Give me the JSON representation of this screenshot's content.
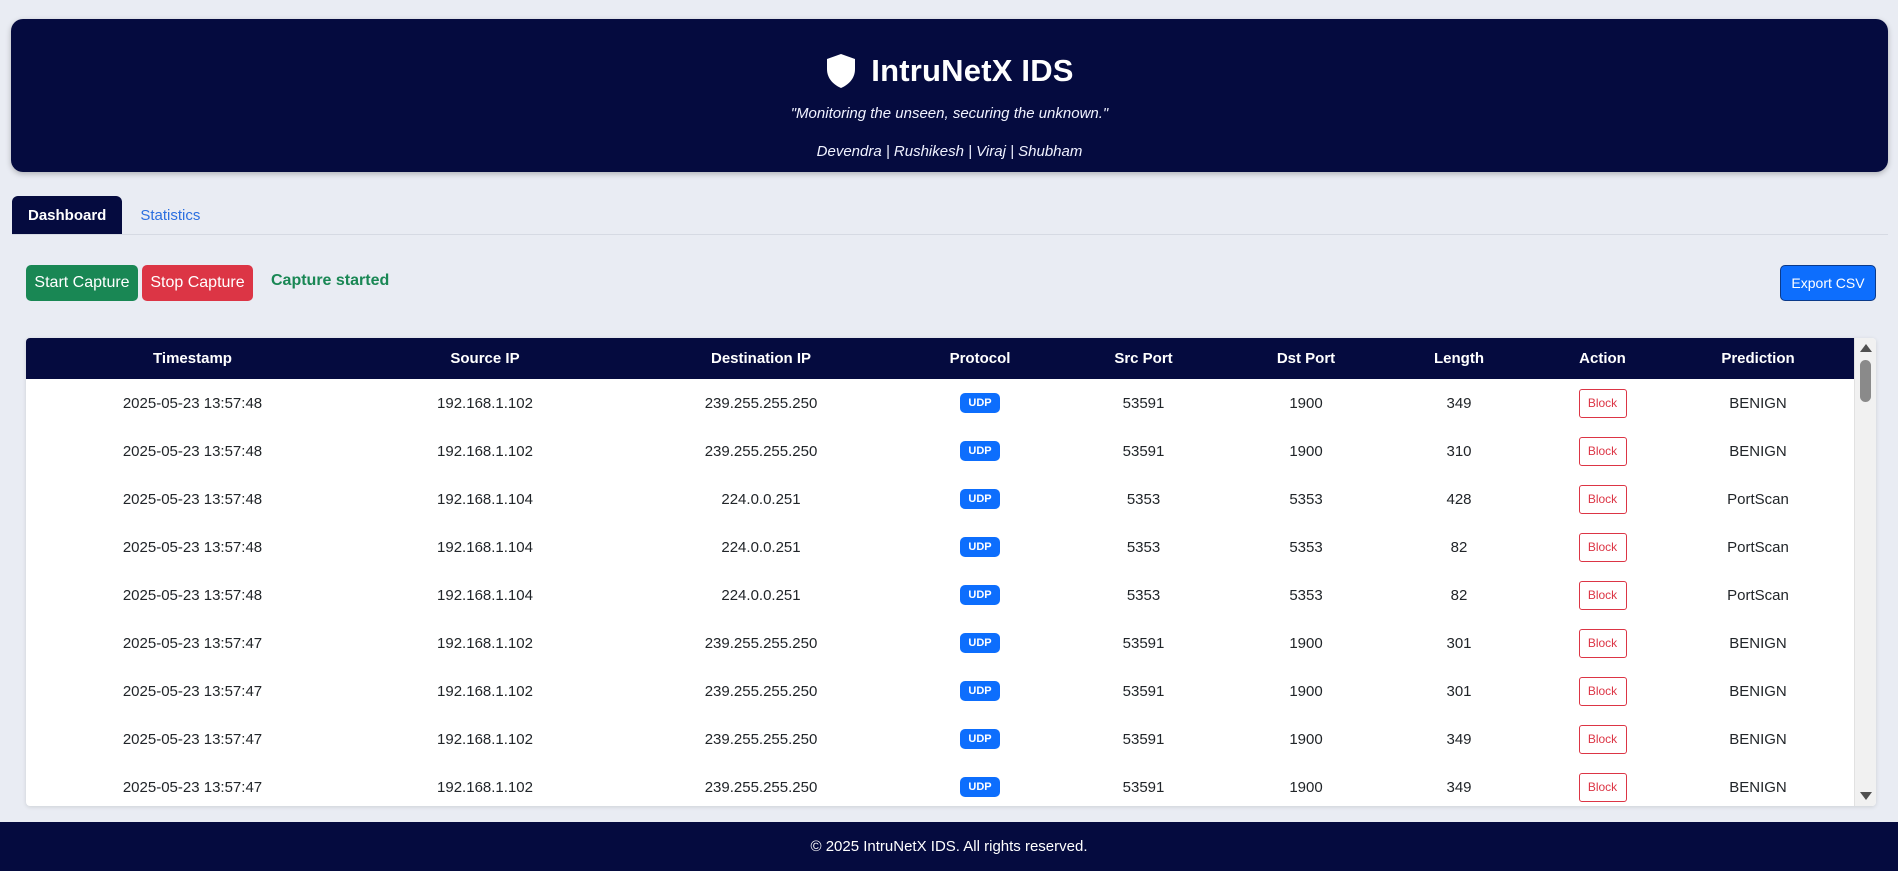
{
  "header": {
    "title": "IntruNetX IDS",
    "tagline": "\"Monitoring the unseen, securing the unknown.\"",
    "team": "Devendra | Rushikesh | Viraj | Shubham",
    "logo_icon": "shield-icon"
  },
  "tabs": [
    {
      "label": "Dashboard",
      "active": true
    },
    {
      "label": "Statistics",
      "active": false
    }
  ],
  "controls": {
    "start_label": "Start Capture",
    "stop_label": "Stop Capture",
    "status": "Capture started",
    "export_label": "Export CSV"
  },
  "table": {
    "columns": [
      "Timestamp",
      "Source IP",
      "Destination IP",
      "Protocol",
      "Src Port",
      "Dst Port",
      "Length",
      "Action",
      "Prediction"
    ],
    "action_label": "Block",
    "rows": [
      {
        "timestamp": "2025-05-23 13:57:48",
        "src_ip": "192.168.1.102",
        "dst_ip": "239.255.255.250",
        "protocol": "UDP",
        "src_port": "53591",
        "dst_port": "1900",
        "length": "349",
        "prediction": "BENIGN"
      },
      {
        "timestamp": "2025-05-23 13:57:48",
        "src_ip": "192.168.1.102",
        "dst_ip": "239.255.255.250",
        "protocol": "UDP",
        "src_port": "53591",
        "dst_port": "1900",
        "length": "310",
        "prediction": "BENIGN"
      },
      {
        "timestamp": "2025-05-23 13:57:48",
        "src_ip": "192.168.1.104",
        "dst_ip": "224.0.0.251",
        "protocol": "UDP",
        "src_port": "5353",
        "dst_port": "5353",
        "length": "428",
        "prediction": "PortScan"
      },
      {
        "timestamp": "2025-05-23 13:57:48",
        "src_ip": "192.168.1.104",
        "dst_ip": "224.0.0.251",
        "protocol": "UDP",
        "src_port": "5353",
        "dst_port": "5353",
        "length": "82",
        "prediction": "PortScan"
      },
      {
        "timestamp": "2025-05-23 13:57:48",
        "src_ip": "192.168.1.104",
        "dst_ip": "224.0.0.251",
        "protocol": "UDP",
        "src_port": "5353",
        "dst_port": "5353",
        "length": "82",
        "prediction": "PortScan"
      },
      {
        "timestamp": "2025-05-23 13:57:47",
        "src_ip": "192.168.1.102",
        "dst_ip": "239.255.255.250",
        "protocol": "UDP",
        "src_port": "53591",
        "dst_port": "1900",
        "length": "301",
        "prediction": "BENIGN"
      },
      {
        "timestamp": "2025-05-23 13:57:47",
        "src_ip": "192.168.1.102",
        "dst_ip": "239.255.255.250",
        "protocol": "UDP",
        "src_port": "53591",
        "dst_port": "1900",
        "length": "301",
        "prediction": "BENIGN"
      },
      {
        "timestamp": "2025-05-23 13:57:47",
        "src_ip": "192.168.1.102",
        "dst_ip": "239.255.255.250",
        "protocol": "UDP",
        "src_port": "53591",
        "dst_port": "1900",
        "length": "349",
        "prediction": "BENIGN"
      },
      {
        "timestamp": "2025-05-23 13:57:47",
        "src_ip": "192.168.1.102",
        "dst_ip": "239.255.255.250",
        "protocol": "UDP",
        "src_port": "53591",
        "dst_port": "1900",
        "length": "349",
        "prediction": "BENIGN"
      }
    ]
  },
  "footer": {
    "text": "© 2025 IntruNetX IDS. All rights reserved."
  },
  "colors": {
    "navy": "#050b3f",
    "start": "#198754",
    "stop": "#dc3545",
    "export": "#0d6efd",
    "badge": "#0d6efd",
    "background": "#e9ecf3"
  }
}
